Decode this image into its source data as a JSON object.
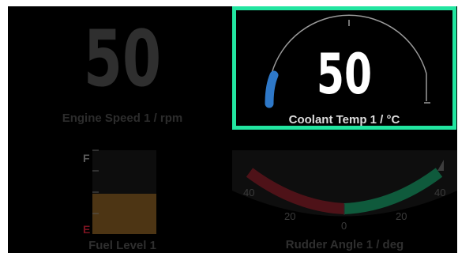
{
  "engine_speed": {
    "value": "50",
    "label": "Engine Speed 1 / rpm"
  },
  "coolant_temp": {
    "value": "50",
    "label": "Coolant Temp 1 / °C",
    "level": 0.08
  },
  "fuel_level": {
    "label": "Fuel Level 1",
    "full_mark": "F",
    "empty_mark": "E",
    "level": 0.48
  },
  "rudder_angle": {
    "label": "Rudder Angle 1 / deg",
    "scale_labels": {
      "outer_left": "40",
      "left": "20",
      "center": "0",
      "right": "20",
      "outer_right": "40"
    }
  },
  "colors": {
    "selection_border": "#22e5a0",
    "coolant_bar": "#2e78c8",
    "fuel_fill": "#4d3514",
    "fuel_empty": "#7a1320",
    "rudder_port": "#4e1218",
    "rudder_starboard": "#0f5a3c",
    "dimmed_text": "#2f2f2f"
  }
}
